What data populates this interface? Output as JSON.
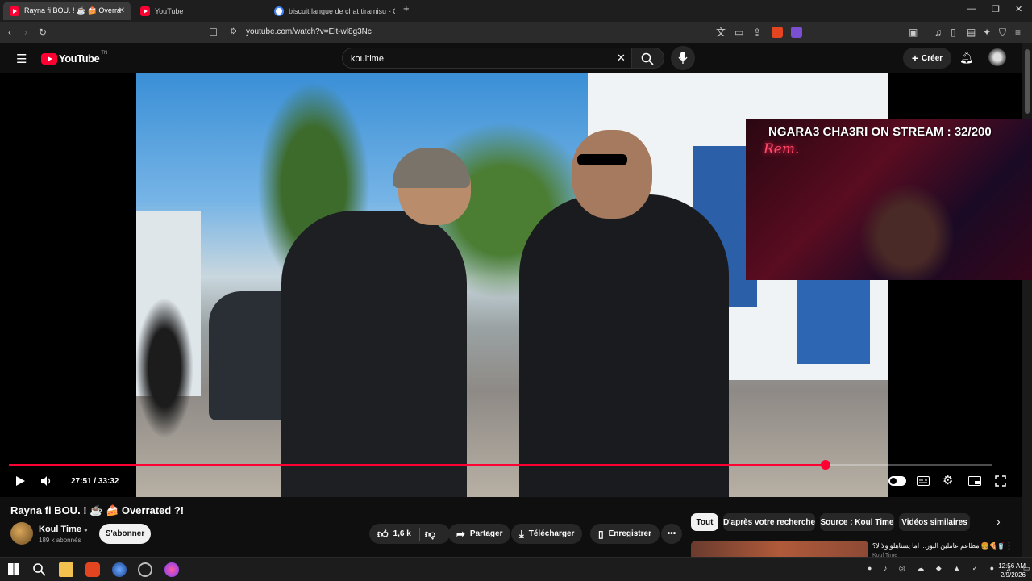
{
  "browser": {
    "tabs": [
      {
        "label": "Rayna fi BOU. ! ☕ 🍰 Overra",
        "active": true
      },
      {
        "label": "YouTube",
        "active": false
      },
      {
        "label": "biscuit langue de chat tiramisu - Goo",
        "active": false
      }
    ],
    "url": "youtube.com/watch?v=Elt-wl8g3Nc"
  },
  "youtube": {
    "logo": "YouTube",
    "country": "TN",
    "search_value": "koultime",
    "create_label": "Créer"
  },
  "player": {
    "time": "27:51 / 33:32",
    "progress": 0.83,
    "overlay_title": "NGARA3 CHA3RI ON STREAM : 32/200",
    "overlay_neon": "Rem."
  },
  "video": {
    "title": "Rayna fi BOU. ! ☕ 🍰 Overrated ?!",
    "channel": "Koul Time",
    "subscribers": "189 k abonnés",
    "subscribe_label": "S'abonner",
    "likes": "1,6 k",
    "share_label": "Partager",
    "download_label": "Télécharger",
    "save_label": "Enregistrer"
  },
  "chips": [
    "Tout",
    "D'après votre recherche",
    "Source : Koul Time",
    "Vidéos similaires"
  ],
  "recommendation": {
    "title": "مطاعم عاملين البوز... اما يستاهلو ولا لا؟ 🍔🍕🥤",
    "channel": "Koul Time"
  },
  "taskbar": {
    "time": "12:56 AM",
    "date": "2/9/2026"
  }
}
